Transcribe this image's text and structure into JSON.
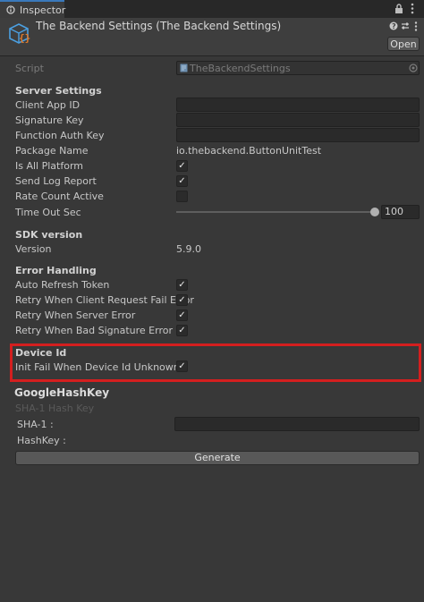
{
  "tab": {
    "label": "Inspector"
  },
  "header": {
    "title": "The Backend Settings (The Backend Settings)",
    "open_label": "Open"
  },
  "script": {
    "label": "Script",
    "value": "TheBackendSettings"
  },
  "server": {
    "title": "Server Settings",
    "client_app_id": "Client App ID",
    "signature_key": "Signature Key",
    "function_auth_key": "Function Auth Key",
    "package_name_label": "Package Name",
    "package_name_value": "io.thebackend.ButtonUnitTest",
    "is_all_platform": {
      "label": "Is All Platform",
      "checked": true
    },
    "send_log_report": {
      "label": "Send Log Report",
      "checked": true
    },
    "rate_count_active": {
      "label": "Rate Count Active",
      "checked": false
    },
    "time_out_label": "Time Out Sec",
    "time_out_value": "100"
  },
  "sdk": {
    "title": "SDK version",
    "version_label": "Version",
    "version_value": "5.9.0"
  },
  "error": {
    "title": "Error Handling",
    "auto_refresh": {
      "label": "Auto Refresh Token",
      "checked": true
    },
    "retry_client": {
      "label": "Retry When Client Request Fail Error",
      "checked": true
    },
    "retry_server": {
      "label": "Retry When Server Error",
      "checked": true
    },
    "retry_signature": {
      "label": "Retry When Bad Signature Error",
      "checked": true
    }
  },
  "device": {
    "title": "Device Id",
    "init_fail": {
      "label": "Init Fail When Device Id Unknown",
      "checked": true
    }
  },
  "google": {
    "title": "GoogleHashKey",
    "sha1_hint": "SHA-1 Hash Key",
    "sha1_label": "SHA-1 :",
    "hashkey_label": "HashKey :",
    "generate_label": "Generate"
  },
  "icons": {
    "check": "✓",
    "lock": "lock-icon",
    "menu": "kebab-menu-icon"
  },
  "colors": {
    "highlight": "#d41f1f",
    "tab_accent": "#3a79bb",
    "background": "#383838"
  }
}
